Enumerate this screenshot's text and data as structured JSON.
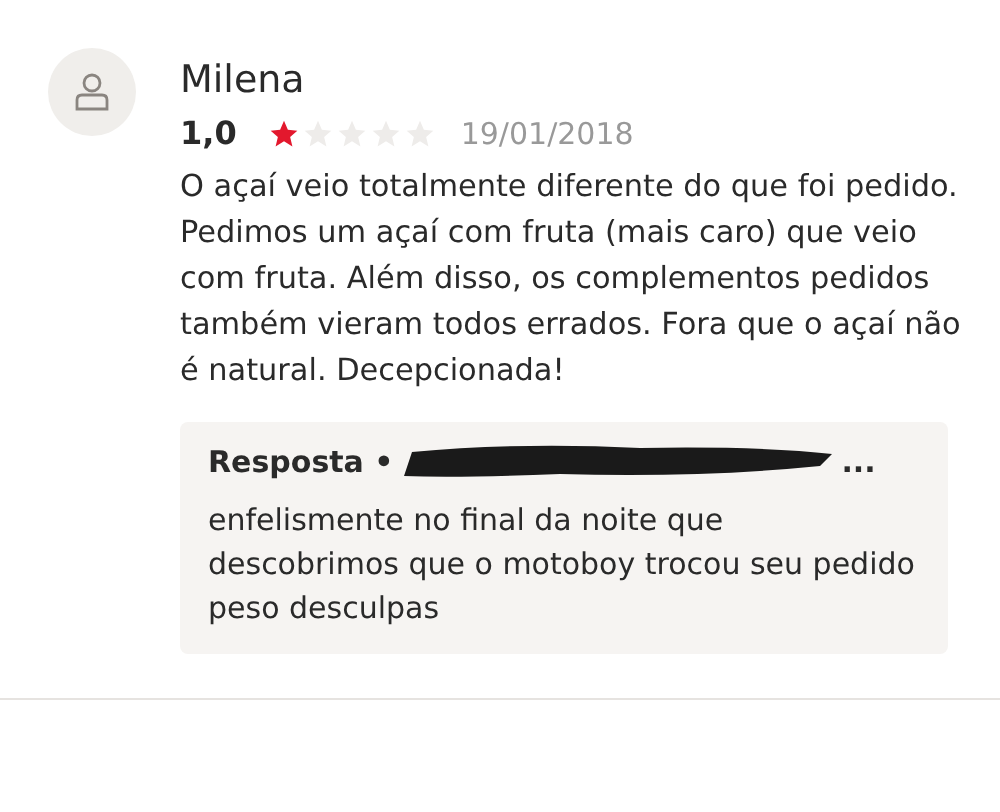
{
  "review": {
    "author": "Milena",
    "rating": "1,0",
    "stars": 1,
    "date": "19/01/2018",
    "text": "O açaí veio totalmente diferente do que foi pedido. Pedimos um açaí com fruta (mais caro) que veio com fruta. Além disso, os complementos pedidos também vieram todos errados. Fora que o açaí não é natural. Decepcionada!"
  },
  "reply": {
    "label": "Resposta •",
    "ellipsis": "...",
    "text": "enfelismente no final da noite que descobrimos que o motoboy trocou seu pedido peso desculpas"
  }
}
